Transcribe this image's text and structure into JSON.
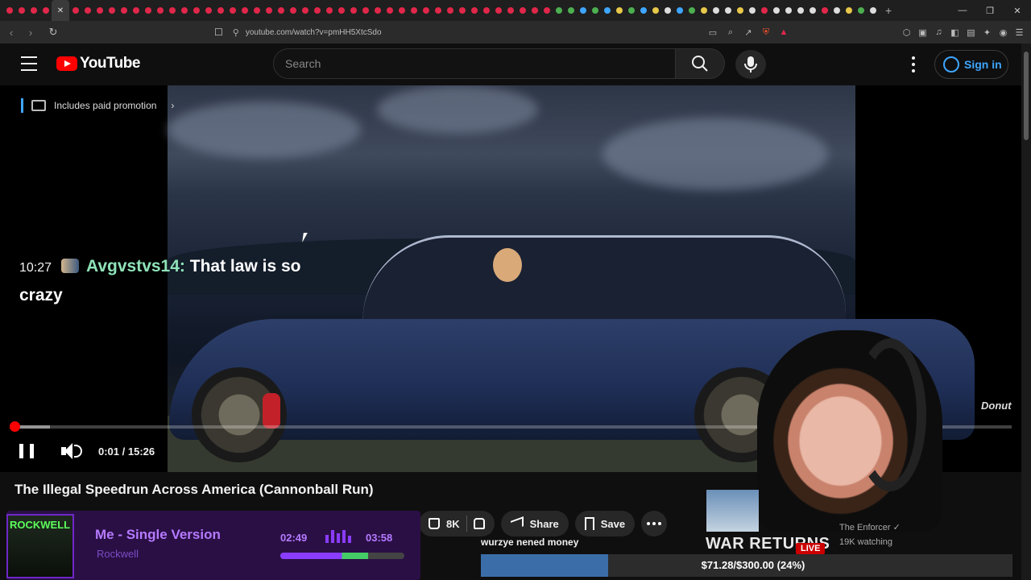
{
  "browser": {
    "tab_count": 72,
    "active_tab_close": "✕",
    "new_tab": "+",
    "window_controls": [
      "—",
      "❐",
      "✕"
    ],
    "url": "youtube.com/watch?v=pmHH5XtcSdo"
  },
  "header": {
    "logo_text": "YouTube",
    "search_placeholder": "Search",
    "sign_in": "Sign in"
  },
  "player": {
    "promo_label": "Includes paid promotion",
    "watermark": "Donut",
    "time_display": "0:01 / 15:26",
    "progress_fraction": 0.0011,
    "buffered_fraction": 0.04
  },
  "chat": {
    "timestamp": "10:27",
    "username": "Avgvstvs14:",
    "message": "That law is so crazy"
  },
  "video": {
    "title": "The Illegal Speedrun Across America (Cannonball Run)",
    "likes": "8K",
    "share": "Share",
    "save": "Save"
  },
  "now_playing": {
    "cover_text": "ROCKWELL",
    "song": "Me - Single Version",
    "artist": "Rockwell",
    "elapsed": "02:49",
    "total": "03:58",
    "progress_fraction": 0.71
  },
  "donation_goal": {
    "message": "wurzye nened money",
    "amount": "$71.28/$300.00 (24%)",
    "fraction": 0.24
  },
  "recommendation": {
    "title": "WAR RETURNS",
    "live": "LIVE",
    "channel": "The Enforcer ✓",
    "watching": "19K watching"
  }
}
